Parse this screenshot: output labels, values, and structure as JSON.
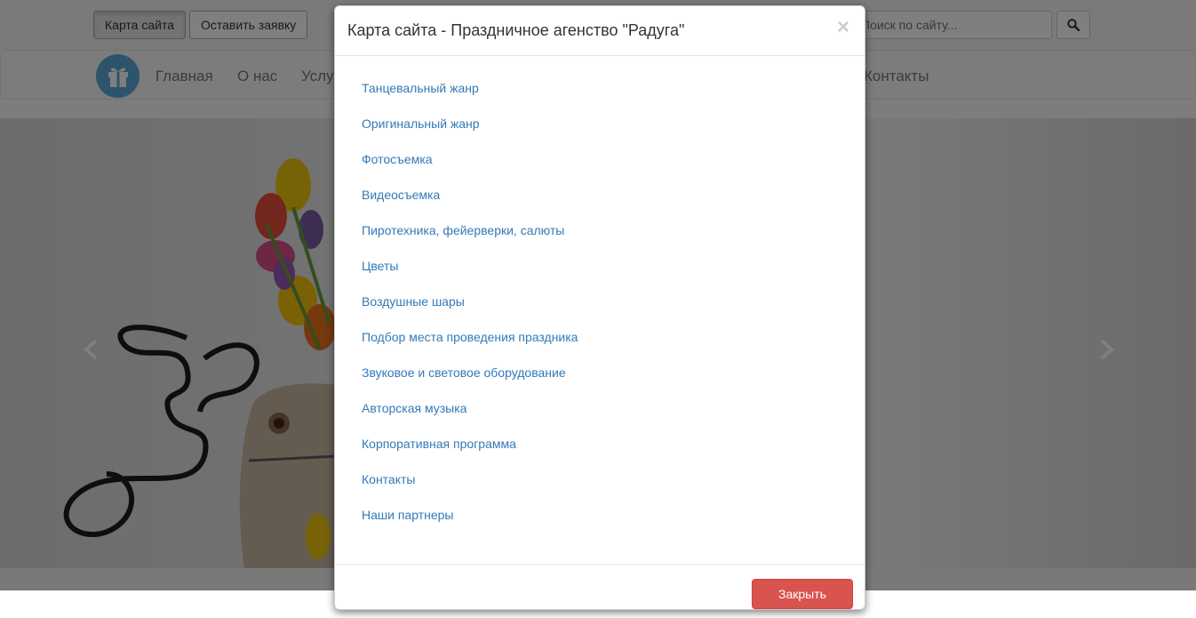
{
  "topbar": {
    "sitemap_button": "Карта сайта",
    "request_button": "Оставить заявку",
    "search_placeholder": "Поиск по сайту..."
  },
  "nav": {
    "items": [
      "Главная",
      "О нас",
      "Услуги",
      "Контакты"
    ]
  },
  "modal": {
    "title": "Карта сайта - Праздничное агенство \"Радуга\"",
    "close_symbol": "×",
    "links": [
      "Танцевальный жанр",
      "Оригинальный жанр",
      "Фотосъемка",
      "Видеосъемка",
      "Пиротехника, фейерверки, салюты",
      "Цветы",
      "Воздушные шары",
      "Подбор места проведения праздника",
      "Звуковое и световое оборудование",
      "Авторская музыка",
      "Корпоративная программа",
      "Контакты",
      "Наши партнеры"
    ],
    "footer_button": "Закрыть"
  },
  "icons": {
    "logo": "gift-icon",
    "search": "search-icon",
    "carousel_prev": "chevron-left-icon",
    "carousel_next": "chevron-right-icon"
  },
  "colors": {
    "link": "#337ab7",
    "logo_bg": "#5aa8d8",
    "danger": "#d9534f"
  }
}
